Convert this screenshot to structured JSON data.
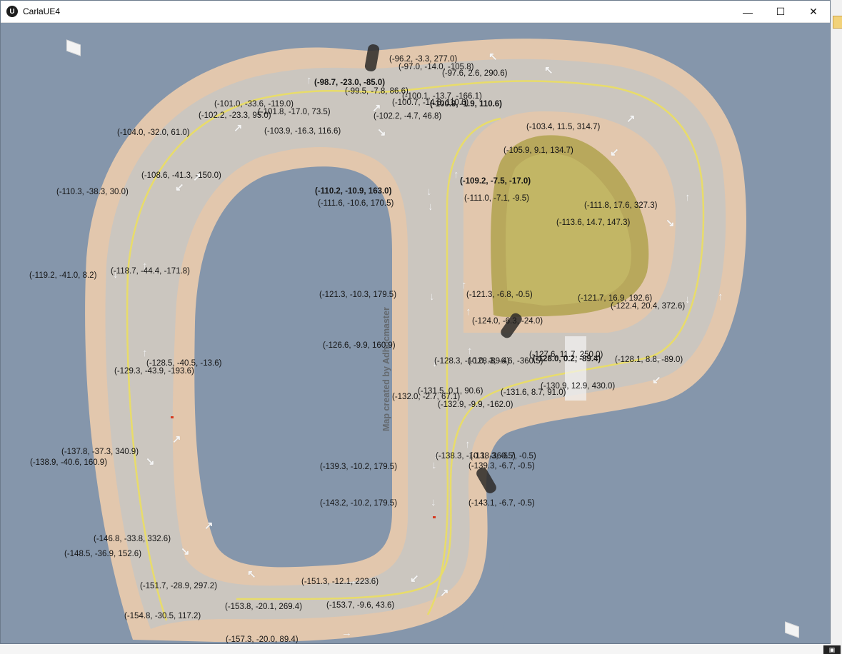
{
  "window": {
    "title": "CarlaUE4",
    "logo_glyph": "U",
    "controls": {
      "minimize": "—",
      "maximize": "☐",
      "close": "✕"
    }
  },
  "colors": {
    "ocean": "#8596ab",
    "sidewalk": "#e2c7ad",
    "road": "#cbc6bf",
    "lane_line": "#e8dc6a",
    "grass": "#b8a85c"
  },
  "viewport": {
    "watermark": "Map created by Adhocmaster",
    "labels": [
      {
        "text": "(-96.2, -3.3, 277.0)"
      },
      {
        "text": "(-97.0, -14.0, -105.8)"
      },
      {
        "text": "(-97.6, 2.6, 290.6)"
      },
      {
        "text": "(-98.7, -23.0, -85.0)",
        "bold": true
      },
      {
        "text": "(-99.5, -7.8, 86.6)"
      },
      {
        "text": "(-100.1, -13.7, -166.1)"
      },
      {
        "text": "(-100.7, -14.8, 110.6)"
      },
      {
        "text": "(-100.9, -1.9, 110.6)",
        "bold": true
      },
      {
        "text": "(-101.0, -33.6, -119.0)"
      },
      {
        "text": "(-101.8, -17.0, 73.5)"
      },
      {
        "text": "(-102.2, -23.3, 95.0)"
      },
      {
        "text": "(-102.2, -4.7, 46.8)"
      },
      {
        "text": "(-103.4, 11.5, 314.7)"
      },
      {
        "text": "(-104.0, -32.0, 61.0)"
      },
      {
        "text": "(-103.9, -16.3, 116.6)"
      },
      {
        "text": "(-105.9, 9.1, 134.7)"
      },
      {
        "text": "(-108.6, -41.3, -150.0)"
      },
      {
        "text": "(-109.2, -7.5, -17.0)",
        "bold": true
      },
      {
        "text": "(-110.3, -38.3, 30.0)"
      },
      {
        "text": "(-110.2, -10.9, 163.0)",
        "bold": true
      },
      {
        "text": "(-111.0, -7.1, -9.5)"
      },
      {
        "text": "(-111.6, -10.6, 170.5)"
      },
      {
        "text": "(-111.8, 17.6, 327.3)"
      },
      {
        "text": "(-113.6, 14.7, 147.3)"
      },
      {
        "text": "(-118.7, -44.4, -171.8)"
      },
      {
        "text": "(-119.2, -41.0, 8.2)"
      },
      {
        "text": "(-121.3, -10.3, 179.5)"
      },
      {
        "text": "(-121.3, -6.8, -0.5)"
      },
      {
        "text": "(-121.7, 16.9, 192.6)"
      },
      {
        "text": "(-122.4, 20.4, 372.6)"
      },
      {
        "text": "(-124.0, -6.3, -24.0)"
      },
      {
        "text": "(-126.6, -9.9, 160.9)"
      },
      {
        "text": "(-127.6, 11.7, 250.0)"
      },
      {
        "text": "(-128.0, 0.2, -89.4)",
        "bold": true
      },
      {
        "text": "(-128.1, 8.8, -89.0)"
      },
      {
        "text": "(-128.3, -10.0, -89.4)"
      },
      {
        "text": "(-128.3, -6.6, -360.5)"
      },
      {
        "text": "(-128.5, -40.5, -13.6)"
      },
      {
        "text": "(-129.3, -43.9, -193.6)"
      },
      {
        "text": "(-130.9, 12.9, 430.0)"
      },
      {
        "text": "(-131.5, 0.1, 90.6)"
      },
      {
        "text": "(-131.6, 8.7, 91.0)"
      },
      {
        "text": "(-132.0, -2.7, 67.1)"
      },
      {
        "text": "(-132.9, -9.9, -162.0)"
      },
      {
        "text": "(-137.8, -37.3, 340.9)"
      },
      {
        "text": "(-138.3, -10.1, -360.5)"
      },
      {
        "text": "(-138.3, -6.7, -0.5)"
      },
      {
        "text": "(-138.9, -40.6, 160.9)"
      },
      {
        "text": "(-139.3, -10.2, 179.5)"
      },
      {
        "text": "(-139.3, -6.7, -0.5)"
      },
      {
        "text": "(-143.2, -10.2, 179.5)"
      },
      {
        "text": "(-143.1, -6.7, -0.5)"
      },
      {
        "text": "(-146.8, -33.8, 332.6)"
      },
      {
        "text": "(-148.5, -36.9, 152.6)"
      },
      {
        "text": "(-151.7, -28.9, 297.2)"
      },
      {
        "text": "(-151.3, -12.1, 223.6)"
      },
      {
        "text": "(-153.8, -20.1, 269.4)"
      },
      {
        "text": "(-153.7, -9.6, 43.6)"
      },
      {
        "text": "(-154.8, -30.5, 117.2)"
      },
      {
        "text": "(-157.3, -20.0, 89.4)"
      }
    ]
  }
}
